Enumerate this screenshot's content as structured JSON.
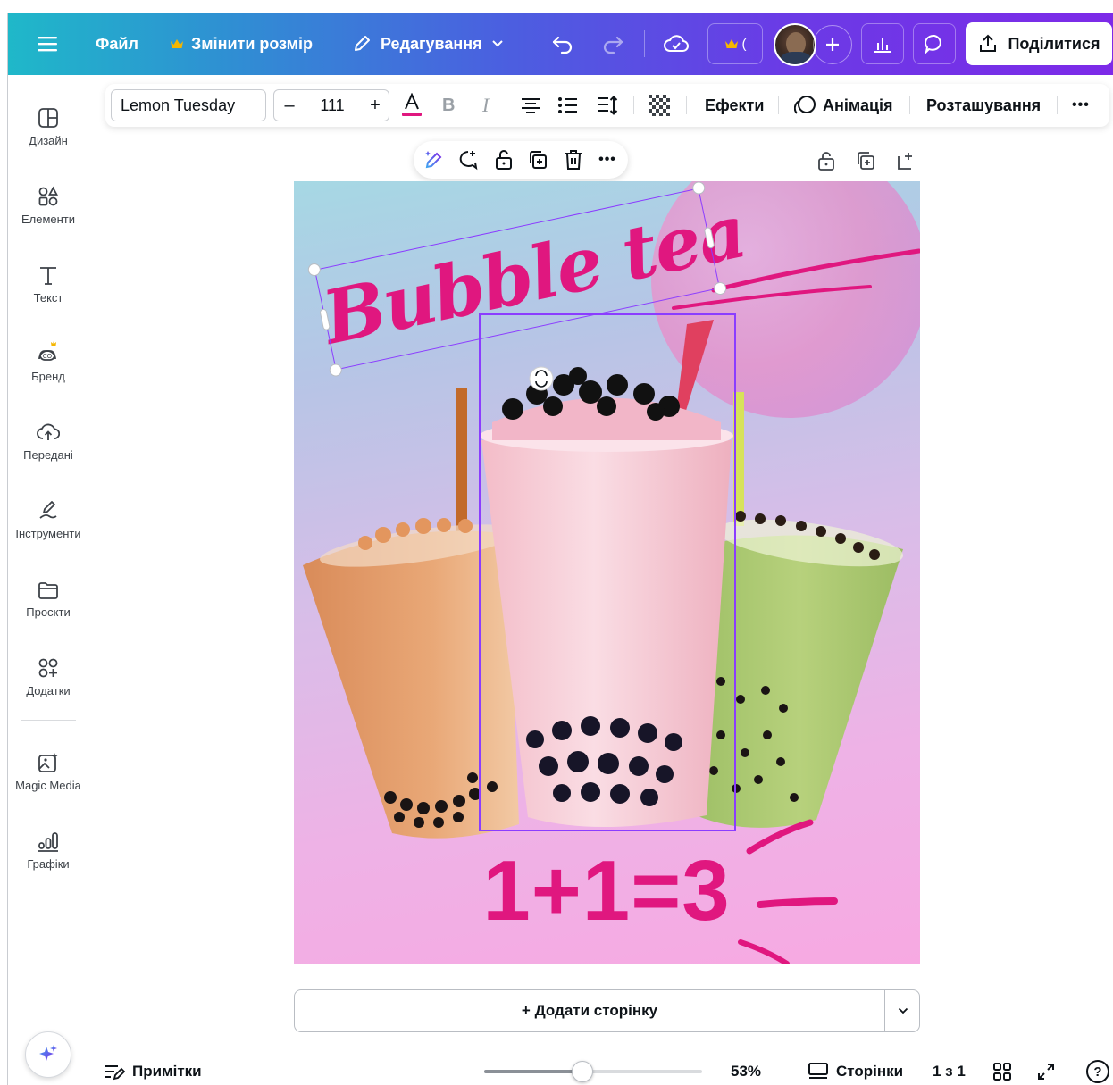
{
  "topbar": {
    "file_label": "Файл",
    "resize_label": "Змінити розмір",
    "edit_label": "Редагування",
    "share_label": "Поділитися"
  },
  "sidebar": {
    "items": [
      {
        "label": "Дизайн",
        "icon": "layout-icon"
      },
      {
        "label": "Елементи",
        "icon": "shapes-icon"
      },
      {
        "label": "Текст",
        "icon": "text-icon"
      },
      {
        "label": "Бренд",
        "icon": "brand-icon"
      },
      {
        "label": "Передані",
        "icon": "upload-cloud-icon"
      },
      {
        "label": "Інструменти",
        "icon": "draw-icon"
      },
      {
        "label": "Проєкти",
        "icon": "folder-icon"
      },
      {
        "label": "Додатки",
        "icon": "apps-icon"
      },
      {
        "label": "Magic Media",
        "icon": "magic-media-icon"
      },
      {
        "label": "Графіки",
        "icon": "charts-icon"
      }
    ]
  },
  "text_toolbar": {
    "font_name": "Lemon Tuesday",
    "font_size": "111",
    "minus": "–",
    "plus": "+",
    "effects_label": "Ефекти",
    "animation_label": "Анімація",
    "position_label": "Розташування",
    "more": "•••"
  },
  "float_toolbar": {
    "more": "•••"
  },
  "design": {
    "title_text": "Bubble tea",
    "promo_text": "1+1=3",
    "accent_color": "#e0177f"
  },
  "add_page": {
    "label": "+ Додати сторінку"
  },
  "bottombar": {
    "notes_label": "Примітки",
    "zoom_percent": "53%",
    "zoom_level": 0.45,
    "pages_label": "Сторінки",
    "page_count": "1 з 1",
    "help": "?"
  },
  "colors": {
    "brand_gradient_start": "#1fb8c9",
    "brand_gradient_end": "#7d2ae8",
    "selection": "#8b3dff",
    "crown": "#f5b600"
  }
}
